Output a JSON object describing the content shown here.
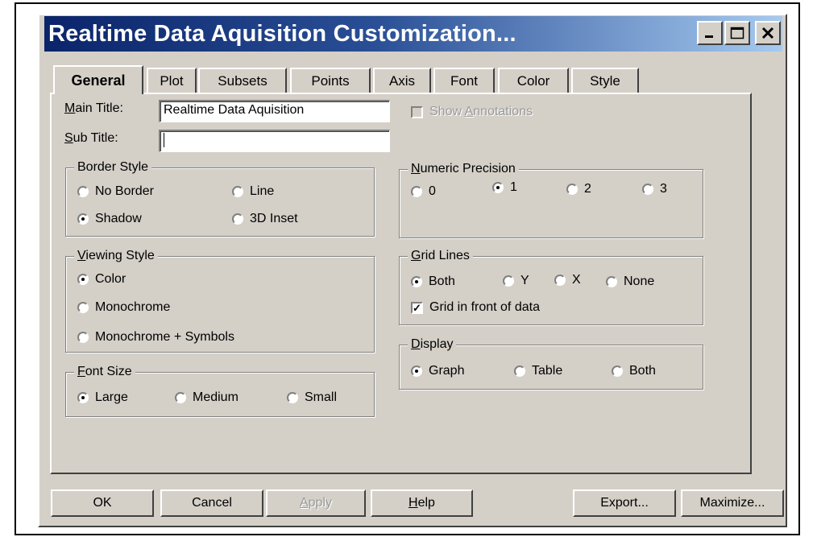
{
  "window": {
    "title": "Realtime Data Aquisition Customization...",
    "caption_buttons": [
      "minimize-icon",
      "maximize-icon",
      "close-icon"
    ]
  },
  "tabs": [
    {
      "label": "General",
      "active": true
    },
    {
      "label": "Plot"
    },
    {
      "label": "Subsets"
    },
    {
      "label": "Points"
    },
    {
      "label": "Axis"
    },
    {
      "label": "Font"
    },
    {
      "label": "Color"
    },
    {
      "label": "Style"
    }
  ],
  "general": {
    "main_title_label": "Main Title:",
    "main_title_value": "Realtime Data Aquisition",
    "sub_title_label": "Sub Title:",
    "sub_title_value": "",
    "show_annotations_label": "Show Annotations",
    "show_annotations_checked": false,
    "border_style": {
      "title": "Border Style",
      "options": [
        "No Border",
        "Line",
        "Shadow",
        "3D Inset"
      ],
      "selected": "Shadow"
    },
    "viewing_style": {
      "title": "Viewing Style",
      "options": [
        "Color",
        "Monochrome",
        "Monochrome + Symbols"
      ],
      "selected": "Color"
    },
    "font_size": {
      "title": "Font Size",
      "options": [
        "Large",
        "Medium",
        "Small"
      ],
      "selected": "Large"
    },
    "numeric_precision": {
      "title": "Numeric Precision",
      "options": [
        "0",
        "1",
        "2",
        "3"
      ],
      "selected": "1"
    },
    "grid_lines": {
      "title": "Grid Lines",
      "options": [
        "Both",
        "Y",
        "X",
        "None"
      ],
      "selected": "Both",
      "grid_in_front_label": "Grid in front of data",
      "grid_in_front_checked": true
    },
    "display": {
      "title": "Display",
      "options": [
        "Graph",
        "Table",
        "Both"
      ],
      "selected": "Graph"
    }
  },
  "buttons": {
    "ok": "OK",
    "cancel": "Cancel",
    "apply": "Apply",
    "help": "Help",
    "export": "Export...",
    "maximize": "Maximize..."
  },
  "colors": {
    "dialog_face": "#d4d0c8",
    "title_gradient_start": "#0a246a",
    "title_gradient_end": "#a6caf0"
  }
}
